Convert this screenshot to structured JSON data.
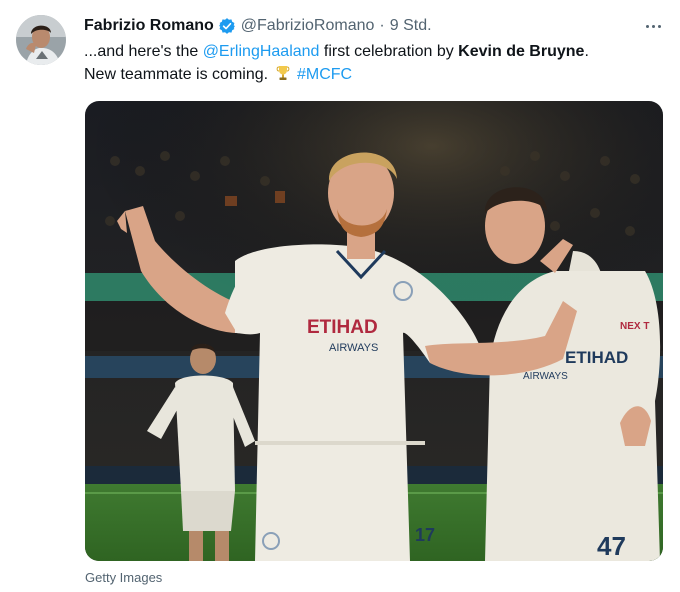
{
  "tweet": {
    "author_name": "Fabrizio Romano",
    "handle": "@FabrizioRomano",
    "separator": "·",
    "timestamp": "9 Std.",
    "text": {
      "part1": "...and here's the ",
      "mention": "@ErlingHaaland",
      "part2": " first celebration by ",
      "bold_name": "Kevin de Bruyne",
      "part3": ".",
      "line2": "New teammate is coming.",
      "hashtag": "#MCFC"
    },
    "media": {
      "sponsor": "ETIHAD",
      "sponsor_sub": "AIRWAYS",
      "number_left": "17",
      "number_right": "47",
      "board_text": "NEX T"
    },
    "photo_credit": "Getty Images"
  },
  "colors": {
    "link": "#1d9bf0",
    "verified": "#1d9bf0",
    "muted": "#536471",
    "text": "#0f1419"
  },
  "icons": {
    "verified": "verified-badge-icon",
    "more": "more-options-icon",
    "emoji": "trophy-emoji-icon"
  }
}
